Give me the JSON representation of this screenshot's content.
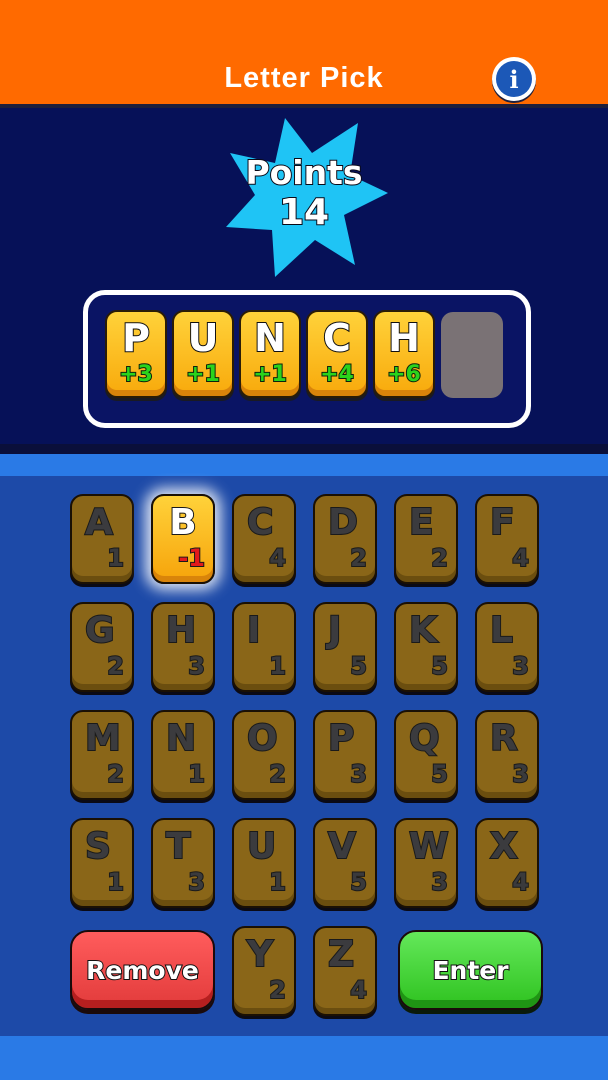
{
  "header": {
    "title": "Letter Pick",
    "info_icon": "info-icon",
    "info_glyph": "i"
  },
  "score": {
    "label": "Points",
    "value": "14"
  },
  "word_tiles": [
    {
      "letter": "P",
      "score": "+3"
    },
    {
      "letter": "U",
      "score": "+1"
    },
    {
      "letter": "N",
      "score": "+1"
    },
    {
      "letter": "C",
      "score": "+4"
    },
    {
      "letter": "H",
      "score": "+6"
    }
  ],
  "keyboard": {
    "rows": [
      [
        {
          "letter": "A",
          "value": "1"
        },
        {
          "letter": "B",
          "value": "-1",
          "selected": true
        },
        {
          "letter": "C",
          "value": "4"
        },
        {
          "letter": "D",
          "value": "2"
        },
        {
          "letter": "E",
          "value": "2"
        },
        {
          "letter": "F",
          "value": "4"
        }
      ],
      [
        {
          "letter": "G",
          "value": "2"
        },
        {
          "letter": "H",
          "value": "3"
        },
        {
          "letter": "I",
          "value": "1"
        },
        {
          "letter": "J",
          "value": "5"
        },
        {
          "letter": "K",
          "value": "5"
        },
        {
          "letter": "L",
          "value": "3"
        }
      ],
      [
        {
          "letter": "M",
          "value": "2"
        },
        {
          "letter": "N",
          "value": "1"
        },
        {
          "letter": "O",
          "value": "2"
        },
        {
          "letter": "P",
          "value": "3"
        },
        {
          "letter": "Q",
          "value": "5"
        },
        {
          "letter": "R",
          "value": "3"
        }
      ],
      [
        {
          "letter": "S",
          "value": "1"
        },
        {
          "letter": "T",
          "value": "3"
        },
        {
          "letter": "U",
          "value": "1"
        },
        {
          "letter": "V",
          "value": "5"
        },
        {
          "letter": "W",
          "value": "3"
        },
        {
          "letter": "X",
          "value": "4"
        }
      ],
      [
        {
          "letter": "Y",
          "value": "2"
        },
        {
          "letter": "Z",
          "value": "4"
        }
      ]
    ]
  },
  "buttons": {
    "remove": "Remove",
    "enter": "Enter"
  },
  "colors": {
    "header": "#ff6a00",
    "score_bg": "#061158",
    "board": "#1d4aa8",
    "tile_gold": "#ffd23a",
    "tile_brown": "#8a6618",
    "star": "#1fc4f5",
    "remove": "#e23b3b",
    "enter": "#2ec21f"
  }
}
